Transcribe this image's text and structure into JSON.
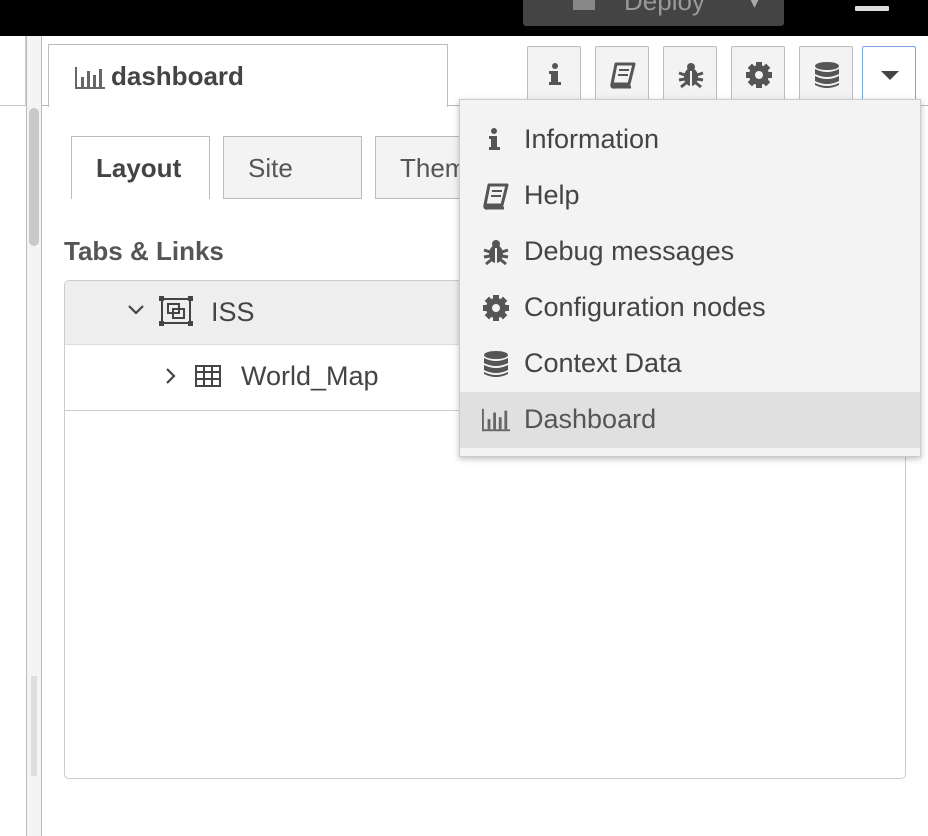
{
  "header": {
    "deploy_label": "Deploy",
    "deploy_caret": "▾"
  },
  "sidebar": {
    "active_tab_label": "dashboard",
    "header_buttons": [
      {
        "name": "info-button",
        "icon": "info-icon"
      },
      {
        "name": "help-button",
        "icon": "book-icon"
      },
      {
        "name": "debug-button",
        "icon": "bug-icon"
      },
      {
        "name": "config-button",
        "icon": "gear-icon"
      },
      {
        "name": "context-button",
        "icon": "database-icon"
      },
      {
        "name": "sidebar-menu-button",
        "icon": "caret-down-icon"
      }
    ]
  },
  "dashboard": {
    "tabs": [
      {
        "label": "Layout",
        "active": true
      },
      {
        "label": "Site",
        "active": false
      },
      {
        "label": "Them",
        "active": false
      }
    ],
    "section_title": "Tabs & Links",
    "tree": {
      "group_label": "ISS",
      "items": [
        {
          "label": "World_Map"
        }
      ]
    }
  },
  "menu": {
    "items": [
      {
        "label": "Information",
        "icon": "info-icon",
        "selected": false
      },
      {
        "label": "Help",
        "icon": "book-icon",
        "selected": false
      },
      {
        "label": "Debug messages",
        "icon": "bug-icon",
        "selected": false
      },
      {
        "label": "Configuration nodes",
        "icon": "gear-icon",
        "selected": false
      },
      {
        "label": "Context Data",
        "icon": "database-icon",
        "selected": false
      },
      {
        "label": "Dashboard",
        "icon": "bar-chart-icon",
        "selected": true
      }
    ]
  },
  "colors": {
    "header_bg": "#000000",
    "menu_bg": "#f3f3f3",
    "selected_item_bg": "#e0e0e0",
    "focus_border": "#7aa7e0"
  }
}
